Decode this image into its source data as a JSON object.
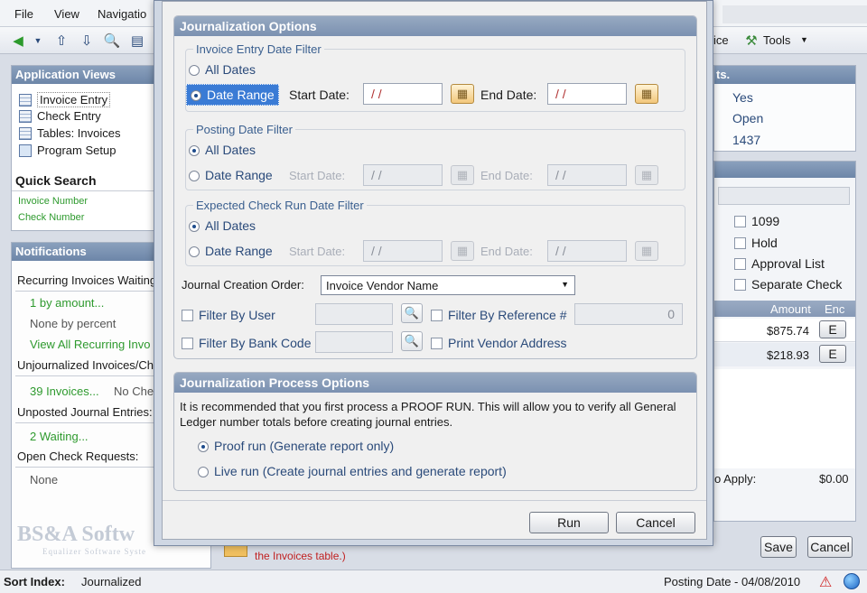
{
  "menu": {
    "file": "File",
    "view": "View",
    "navigation": "Navigatio"
  },
  "toolbar": {
    "ice_label": "ice",
    "tools_label": "Tools"
  },
  "left": {
    "app_views_title": "Application Views",
    "app_views": [
      "Invoice Entry",
      "Check Entry",
      "Tables: Invoices",
      "Program Setup"
    ],
    "quick_search_title": "Quick Search",
    "quick_search": [
      "Invoice Number",
      "Check Number"
    ],
    "notifications_title": "Notifications",
    "recurring": "Recurring Invoices Waiting",
    "by_amount": "1 by amount...",
    "by_percent": "None by percent",
    "view_all": "View All Recurring Invo",
    "unjournalized": "Unjournalized Invoices/Ch",
    "invoices_39": "39 Invoices...",
    "no_che": "No Che",
    "unposted": "Unposted Journal Entries:",
    "waiting": "2 Waiting...",
    "open_check": "Open Check Requests:",
    "none": "None",
    "logo": "BS&A Softw",
    "logo_sub": "Equalizer Software Syste"
  },
  "right": {
    "header_frag": "ts.",
    "yes": "Yes",
    "open": "Open",
    "num": "1437",
    "cb_1099": "1099",
    "cb_hold": "Hold",
    "cb_approval": "Approval List",
    "cb_separate": "Separate Check",
    "col_amount": "Amount",
    "col_enc": "Enc",
    "amounts": [
      "$875.74",
      "$218.93"
    ],
    "enc_btn": "E",
    "apply_label": "o Apply:",
    "apply_value": "$0.00",
    "save": "Save",
    "cancel": "Cancel",
    "invoices_table_note": "the Invoices table.)"
  },
  "dialog": {
    "options_title": "Journalization Options",
    "invoice_filter": {
      "legend": "Invoice Entry Date Filter",
      "all_dates": "All Dates",
      "date_range": "Date Range",
      "start_label": "Start Date:",
      "start_value": "/ /",
      "end_label": "End Date:",
      "end_value": "/ /"
    },
    "posting_filter": {
      "legend": "Posting Date Filter",
      "all_dates": "All Dates",
      "date_range": "Date Range",
      "start_label": "Start Date:",
      "start_value": "/ /",
      "end_label": "End Date:",
      "end_value": "/ /"
    },
    "check_filter": {
      "legend": "Expected Check Run Date Filter",
      "all_dates": "All Dates",
      "date_range": "Date Range",
      "start_label": "Start Date:",
      "start_value": "/ /",
      "end_label": "End Date:",
      "end_value": "/ /"
    },
    "order_label": "Journal Creation Order:",
    "order_value": "Invoice Vendor Name",
    "filter_user": "Filter By User",
    "filter_reference": "Filter By Reference #",
    "reference_value": "0",
    "filter_bank": "Filter By Bank Code",
    "print_vendor": "Print Vendor Address",
    "process_title": "Journalization Process Options",
    "process_text": "It is recommended that you first process a PROOF RUN.  This will allow you to verify all General Ledger number totals before creating journal entries.",
    "proof_run": "Proof run (Generate report only)",
    "live_run": "Live run (Create journal entries and generate report)",
    "run": "Run",
    "cancel": "Cancel"
  },
  "status": {
    "sort_label": "Sort Index:",
    "sort_value": "Journalized",
    "posting": "Posting Date - 04/08/2010"
  }
}
